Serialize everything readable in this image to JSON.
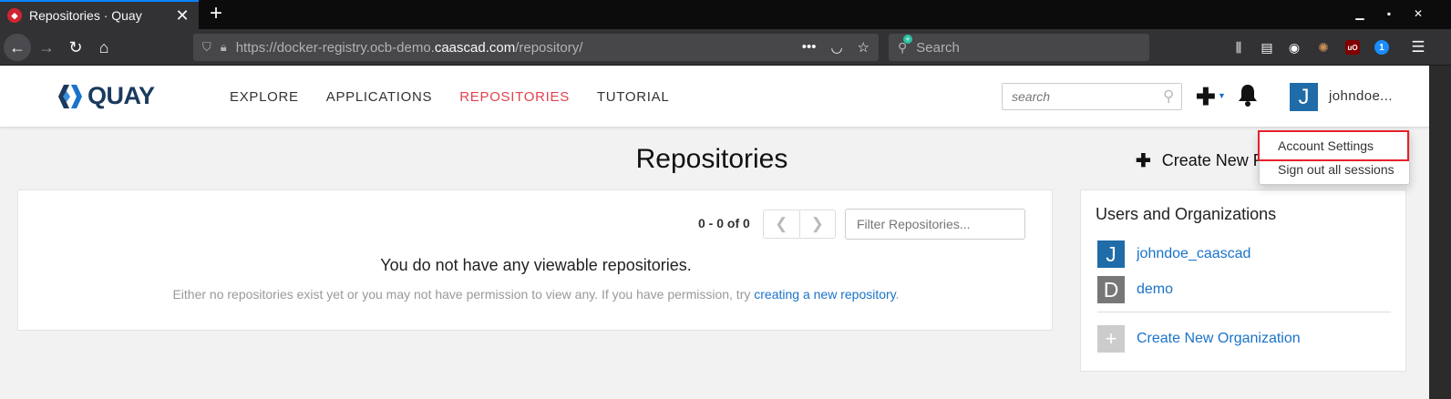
{
  "browser": {
    "tab_title": "Repositories · Quay",
    "tab_favicon": "quay-favicon",
    "url_prefix": "https://docker-registry.ocb-demo.",
    "url_domain": "caascad.com",
    "url_suffix": "/repository/",
    "search_placeholder": "Search",
    "icons": [
      "back-icon",
      "forward-icon",
      "reload-icon",
      "home-icon",
      "shield-icon",
      "lock-icon",
      "more-icon",
      "pocket-icon",
      "bookmark-star-icon",
      "library-icon",
      "sidebar-icon",
      "account-icon",
      "extension-icon",
      "ublock-icon",
      "onepassword-icon",
      "menu-icon"
    ]
  },
  "quay": {
    "logo_text": "QUAY",
    "nav": [
      {
        "label": "EXPLORE",
        "active": false
      },
      {
        "label": "APPLICATIONS",
        "active": false
      },
      {
        "label": "REPOSITORIES",
        "active": true
      },
      {
        "label": "TUTORIAL",
        "active": false
      }
    ],
    "search_placeholder": "search",
    "user_initial": "J",
    "username": "johndoe..."
  },
  "main": {
    "title": "Repositories",
    "create_button": "Create New R",
    "paging_text": "0 - 0 of 0",
    "filter_placeholder": "Filter Repositories...",
    "empty_title": "You do not have any viewable repositories.",
    "empty_desc_prefix": "Either no repositories exist yet or you may not have permission to view any. If you have permission, try ",
    "empty_desc_link": "creating a new repository",
    "empty_desc_suffix": "."
  },
  "orgs": {
    "title": "Users and Organizations",
    "items": [
      {
        "initial": "J",
        "name": "johndoe_caascad",
        "color": "#1f6ca8"
      },
      {
        "initial": "D",
        "name": "demo",
        "color": "#777777"
      }
    ],
    "create_label": "Create New Organization",
    "create_color": "#cccccc"
  },
  "dropdown": {
    "items": [
      "Account Settings",
      "Sign out all sessions"
    ],
    "highlight_color": "#e4222c"
  },
  "colors": {
    "accent": "#1a73c9",
    "nav_active": "#e0424f",
    "quay_navy": "#1a3a5e"
  }
}
